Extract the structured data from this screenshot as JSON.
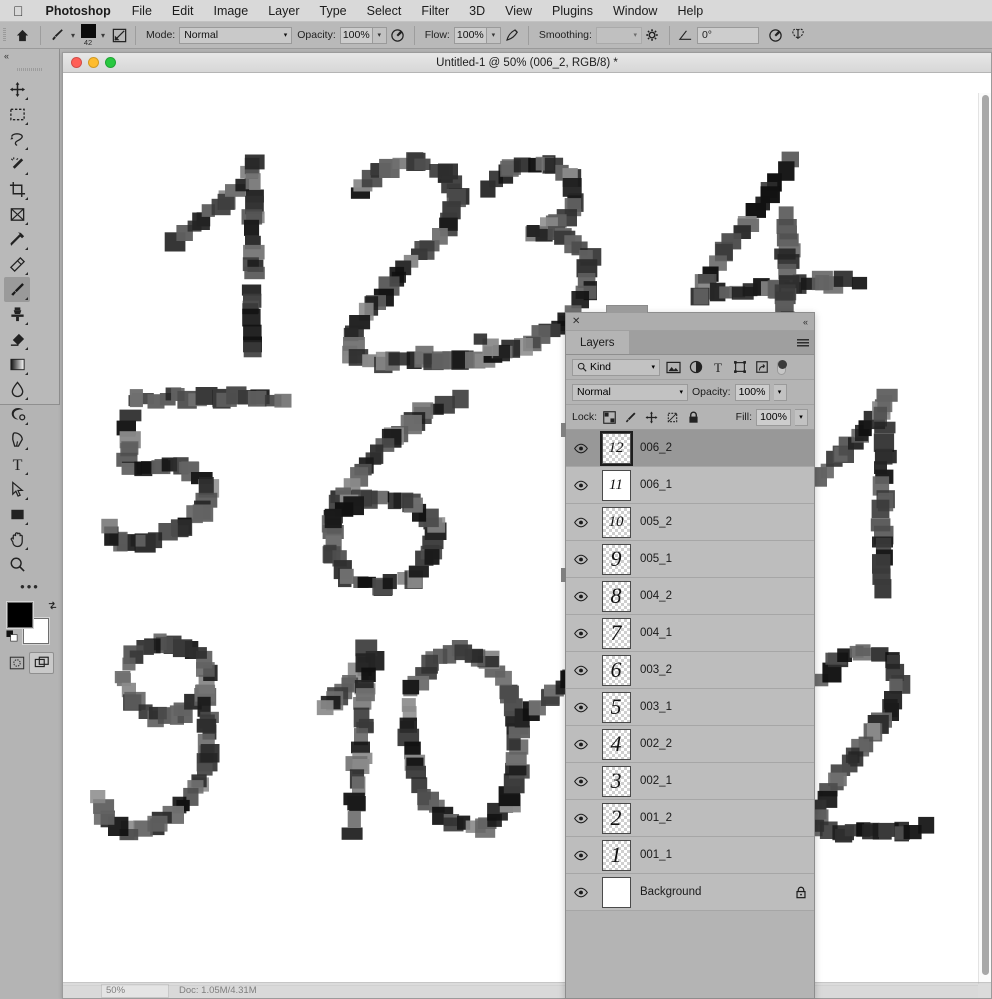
{
  "menubar": {
    "apple_icon": "apple-logo",
    "app_name": "Photoshop",
    "items": [
      "File",
      "Edit",
      "Image",
      "Layer",
      "Type",
      "Select",
      "Filter",
      "3D",
      "View",
      "Plugins",
      "Window",
      "Help"
    ]
  },
  "options_bar": {
    "home_icon": "home-icon",
    "tool_icon": "brush-tool-icon",
    "brush_size": "42",
    "brush_preset_icon": "brush-preset-picker-icon",
    "brush_panel_icon": "brush-settings-panel-icon",
    "mode_label": "Mode:",
    "mode_value": "Normal",
    "opacity_label": "Opacity:",
    "opacity_value": "100%",
    "opacity_pressure_icon": "pressure-opacity-icon",
    "flow_label": "Flow:",
    "flow_value": "100%",
    "airbrush_icon": "airbrush-icon",
    "smoothing_label": "Smoothing:",
    "smoothing_value": "",
    "smoothing_options_icon": "gear-icon",
    "angle_icon": "angle-icon",
    "angle_value": "0°",
    "symmetry_pressure_icon": "pressure-size-icon",
    "symmetry_icon": "symmetry-butterfly-icon"
  },
  "toolbar": {
    "collapse_icon": "collapse-chevrons-icon",
    "tools": [
      {
        "name": "move-tool",
        "glyph": "move"
      },
      {
        "name": "rectangular-marquee-tool",
        "glyph": "marquee"
      },
      {
        "name": "lasso-tool",
        "glyph": "lasso"
      },
      {
        "name": "magic-wand-tool",
        "glyph": "wand"
      },
      {
        "name": "crop-tool",
        "glyph": "crop"
      },
      {
        "name": "frame-tool",
        "glyph": "frame"
      },
      {
        "name": "eyedropper-tool",
        "glyph": "eyedropper"
      },
      {
        "name": "healing-brush-tool",
        "glyph": "healing"
      },
      {
        "name": "brush-tool",
        "glyph": "brush",
        "active": true
      },
      {
        "name": "clone-stamp-tool",
        "glyph": "stamp"
      },
      {
        "name": "eraser-tool",
        "glyph": "eraser"
      },
      {
        "name": "gradient-tool",
        "glyph": "gradient"
      },
      {
        "name": "blur-tool",
        "glyph": "blur"
      },
      {
        "name": "dodge-tool",
        "glyph": "dodge"
      },
      {
        "name": "pen-tool",
        "glyph": "pen"
      },
      {
        "name": "type-tool",
        "glyph": "type"
      },
      {
        "name": "path-selection-tool",
        "glyph": "arrow"
      },
      {
        "name": "rectangle-tool",
        "glyph": "rect"
      },
      {
        "name": "hand-tool",
        "glyph": "hand"
      },
      {
        "name": "zoom-tool",
        "glyph": "zoom"
      }
    ],
    "more_tools_icon": "more-tools-icon",
    "foreground_color": "#000000",
    "background_color": "#ffffff",
    "swap_colors_icon": "swap-colors-icon",
    "default_colors_icon": "default-colors-icon",
    "quick_mask_icon": "quick-mask-icon",
    "screen_mode_icon": "screen-mode-icon"
  },
  "document": {
    "title": "Untitled-1 @ 50% (006_2, RGB/8) *",
    "zoom": "50%",
    "status_info": "Doc: 1.05M/4.31M",
    "traffic_lights": [
      "close-button",
      "minimize-button",
      "maximize-button"
    ]
  },
  "canvas": {
    "digits": [
      "1",
      "2",
      "3",
      "4",
      "5",
      "6",
      "9",
      "10",
      "1",
      "2"
    ],
    "background": "#ffffff"
  },
  "layers_panel": {
    "close_icon": "close-icon",
    "collapse_icon": "collapse-chevrons-icon",
    "tab_label": "Layers",
    "menu_icon": "panel-menu-icon",
    "filter": {
      "kind_label": "Kind",
      "search_icon": "search-icon",
      "chevron_icon": "chevron-down-icon",
      "filter_icons": [
        "filter-pixel-icon",
        "filter-adjustment-icon",
        "filter-type-icon",
        "filter-shape-icon",
        "filter-smart-object-icon"
      ],
      "toggle_icon": "filter-toggle-switch"
    },
    "blend_mode_label": "Normal",
    "opacity_label": "Opacity:",
    "opacity_value": "100%",
    "lock_label": "Lock:",
    "lock_icons": [
      "lock-transparent-pixels-icon",
      "lock-image-pixels-icon",
      "lock-position-icon",
      "lock-artboard-nesting-icon",
      "lock-all-icon"
    ],
    "fill_label": "Fill:",
    "fill_value": "100%",
    "layers": [
      {
        "name": "006_2",
        "visible": true,
        "selected": true,
        "locked": false,
        "thumb": "12",
        "transparent": true
      },
      {
        "name": "006_1",
        "visible": true,
        "selected": false,
        "locked": false,
        "thumb": "11",
        "transparent": false
      },
      {
        "name": "005_2",
        "visible": true,
        "selected": false,
        "locked": false,
        "thumb": "10",
        "transparent": true
      },
      {
        "name": "005_1",
        "visible": true,
        "selected": false,
        "locked": false,
        "thumb": "9",
        "transparent": true
      },
      {
        "name": "004_2",
        "visible": true,
        "selected": false,
        "locked": false,
        "thumb": "8",
        "transparent": true
      },
      {
        "name": "004_1",
        "visible": true,
        "selected": false,
        "locked": false,
        "thumb": "7",
        "transparent": true
      },
      {
        "name": "003_2",
        "visible": true,
        "selected": false,
        "locked": false,
        "thumb": "6",
        "transparent": true
      },
      {
        "name": "003_1",
        "visible": true,
        "selected": false,
        "locked": false,
        "thumb": "5",
        "transparent": true
      },
      {
        "name": "002_2",
        "visible": true,
        "selected": false,
        "locked": false,
        "thumb": "4",
        "transparent": true
      },
      {
        "name": "002_1",
        "visible": true,
        "selected": false,
        "locked": false,
        "thumb": "3",
        "transparent": true
      },
      {
        "name": "001_2",
        "visible": true,
        "selected": false,
        "locked": false,
        "thumb": "2",
        "transparent": true
      },
      {
        "name": "001_1",
        "visible": true,
        "selected": false,
        "locked": false,
        "thumb": "1",
        "transparent": true
      },
      {
        "name": "Background",
        "visible": true,
        "selected": false,
        "locked": true,
        "thumb": "",
        "transparent": false
      }
    ]
  },
  "colors": {
    "menubar_bg": "#d9d9d9",
    "options_bg": "#b9b9b9",
    "panel_bg": "#b4b4b4",
    "layer_row_bg": "#bdbdbd",
    "layer_selected_bg": "#989898",
    "canvas_bg": "#ffffff",
    "desktop_bg": "#b4b4b4"
  }
}
